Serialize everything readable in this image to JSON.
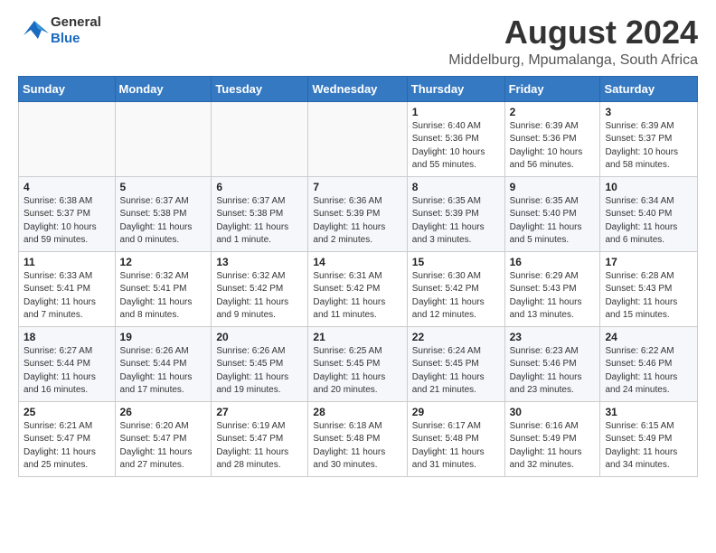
{
  "header": {
    "logo_general": "General",
    "logo_blue": "Blue",
    "title": "August 2024",
    "subtitle": "Middelburg, Mpumalanga, South Africa"
  },
  "weekdays": [
    "Sunday",
    "Monday",
    "Tuesday",
    "Wednesday",
    "Thursday",
    "Friday",
    "Saturday"
  ],
  "weeks": [
    [
      {
        "day": "",
        "info": ""
      },
      {
        "day": "",
        "info": ""
      },
      {
        "day": "",
        "info": ""
      },
      {
        "day": "",
        "info": ""
      },
      {
        "day": "1",
        "info": "Sunrise: 6:40 AM\nSunset: 5:36 PM\nDaylight: 10 hours and 55 minutes."
      },
      {
        "day": "2",
        "info": "Sunrise: 6:39 AM\nSunset: 5:36 PM\nDaylight: 10 hours and 56 minutes."
      },
      {
        "day": "3",
        "info": "Sunrise: 6:39 AM\nSunset: 5:37 PM\nDaylight: 10 hours and 58 minutes."
      }
    ],
    [
      {
        "day": "4",
        "info": "Sunrise: 6:38 AM\nSunset: 5:37 PM\nDaylight: 10 hours and 59 minutes."
      },
      {
        "day": "5",
        "info": "Sunrise: 6:37 AM\nSunset: 5:38 PM\nDaylight: 11 hours and 0 minutes."
      },
      {
        "day": "6",
        "info": "Sunrise: 6:37 AM\nSunset: 5:38 PM\nDaylight: 11 hours and 1 minute."
      },
      {
        "day": "7",
        "info": "Sunrise: 6:36 AM\nSunset: 5:39 PM\nDaylight: 11 hours and 2 minutes."
      },
      {
        "day": "8",
        "info": "Sunrise: 6:35 AM\nSunset: 5:39 PM\nDaylight: 11 hours and 3 minutes."
      },
      {
        "day": "9",
        "info": "Sunrise: 6:35 AM\nSunset: 5:40 PM\nDaylight: 11 hours and 5 minutes."
      },
      {
        "day": "10",
        "info": "Sunrise: 6:34 AM\nSunset: 5:40 PM\nDaylight: 11 hours and 6 minutes."
      }
    ],
    [
      {
        "day": "11",
        "info": "Sunrise: 6:33 AM\nSunset: 5:41 PM\nDaylight: 11 hours and 7 minutes."
      },
      {
        "day": "12",
        "info": "Sunrise: 6:32 AM\nSunset: 5:41 PM\nDaylight: 11 hours and 8 minutes."
      },
      {
        "day": "13",
        "info": "Sunrise: 6:32 AM\nSunset: 5:42 PM\nDaylight: 11 hours and 9 minutes."
      },
      {
        "day": "14",
        "info": "Sunrise: 6:31 AM\nSunset: 5:42 PM\nDaylight: 11 hours and 11 minutes."
      },
      {
        "day": "15",
        "info": "Sunrise: 6:30 AM\nSunset: 5:42 PM\nDaylight: 11 hours and 12 minutes."
      },
      {
        "day": "16",
        "info": "Sunrise: 6:29 AM\nSunset: 5:43 PM\nDaylight: 11 hours and 13 minutes."
      },
      {
        "day": "17",
        "info": "Sunrise: 6:28 AM\nSunset: 5:43 PM\nDaylight: 11 hours and 15 minutes."
      }
    ],
    [
      {
        "day": "18",
        "info": "Sunrise: 6:27 AM\nSunset: 5:44 PM\nDaylight: 11 hours and 16 minutes."
      },
      {
        "day": "19",
        "info": "Sunrise: 6:26 AM\nSunset: 5:44 PM\nDaylight: 11 hours and 17 minutes."
      },
      {
        "day": "20",
        "info": "Sunrise: 6:26 AM\nSunset: 5:45 PM\nDaylight: 11 hours and 19 minutes."
      },
      {
        "day": "21",
        "info": "Sunrise: 6:25 AM\nSunset: 5:45 PM\nDaylight: 11 hours and 20 minutes."
      },
      {
        "day": "22",
        "info": "Sunrise: 6:24 AM\nSunset: 5:45 PM\nDaylight: 11 hours and 21 minutes."
      },
      {
        "day": "23",
        "info": "Sunrise: 6:23 AM\nSunset: 5:46 PM\nDaylight: 11 hours and 23 minutes."
      },
      {
        "day": "24",
        "info": "Sunrise: 6:22 AM\nSunset: 5:46 PM\nDaylight: 11 hours and 24 minutes."
      }
    ],
    [
      {
        "day": "25",
        "info": "Sunrise: 6:21 AM\nSunset: 5:47 PM\nDaylight: 11 hours and 25 minutes."
      },
      {
        "day": "26",
        "info": "Sunrise: 6:20 AM\nSunset: 5:47 PM\nDaylight: 11 hours and 27 minutes."
      },
      {
        "day": "27",
        "info": "Sunrise: 6:19 AM\nSunset: 5:47 PM\nDaylight: 11 hours and 28 minutes."
      },
      {
        "day": "28",
        "info": "Sunrise: 6:18 AM\nSunset: 5:48 PM\nDaylight: 11 hours and 30 minutes."
      },
      {
        "day": "29",
        "info": "Sunrise: 6:17 AM\nSunset: 5:48 PM\nDaylight: 11 hours and 31 minutes."
      },
      {
        "day": "30",
        "info": "Sunrise: 6:16 AM\nSunset: 5:49 PM\nDaylight: 11 hours and 32 minutes."
      },
      {
        "day": "31",
        "info": "Sunrise: 6:15 AM\nSunset: 5:49 PM\nDaylight: 11 hours and 34 minutes."
      }
    ]
  ]
}
